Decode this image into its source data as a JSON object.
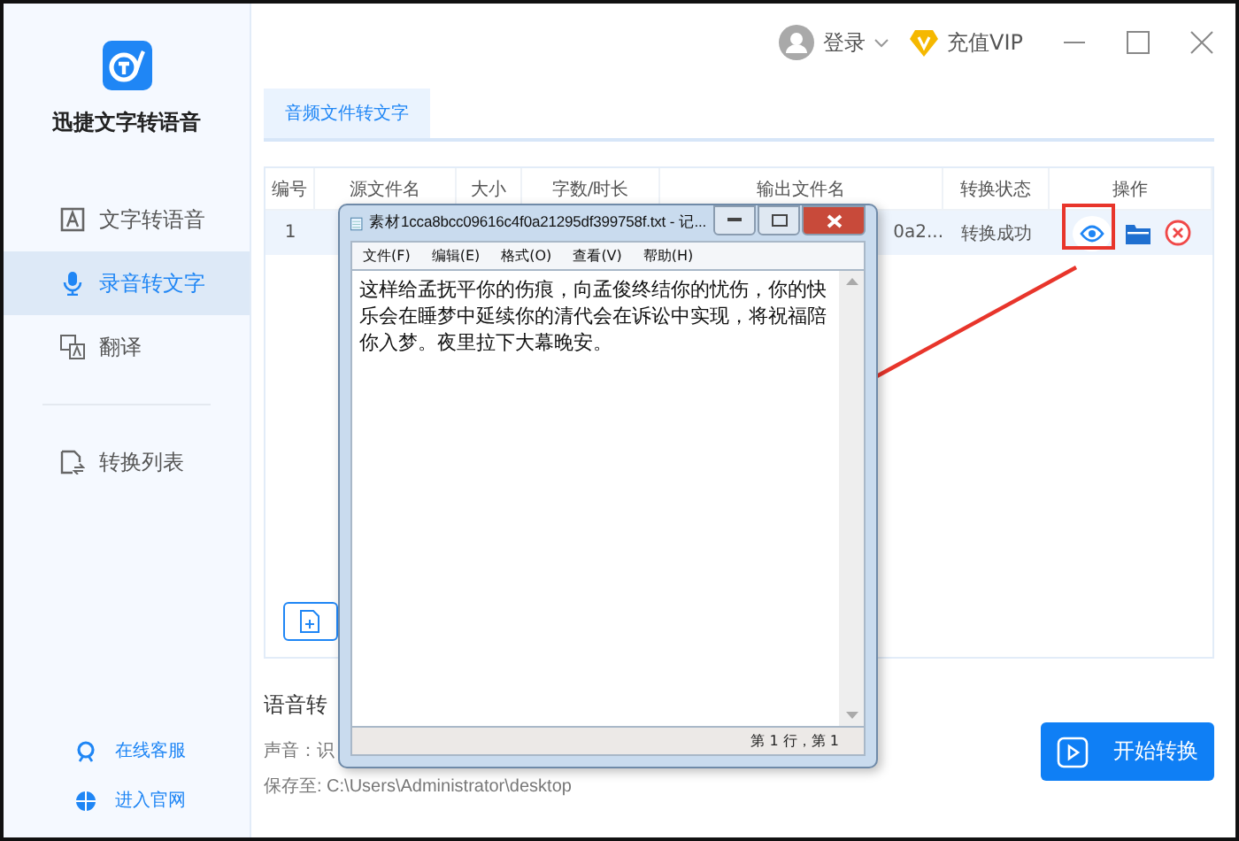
{
  "app": {
    "name": "迅捷文字转语音"
  },
  "sidebar": {
    "items": [
      {
        "label": "文字转语音",
        "selected": false
      },
      {
        "label": "录音转文字",
        "selected": true
      },
      {
        "label": "翻译",
        "selected": false
      },
      {
        "label": "转换列表",
        "selected": false
      }
    ],
    "links": [
      "在线客服",
      "进入官网"
    ]
  },
  "header": {
    "login": "登录",
    "vip": "充值VIP"
  },
  "tabs": [
    {
      "label": "音频文件转文字",
      "selected": true
    }
  ],
  "table": {
    "columns": [
      "编号",
      "源文件名",
      "大小",
      "字数/时长",
      "输出文件名",
      "转换状态",
      "操作"
    ],
    "rows": [
      {
        "index": "1",
        "output_name": "0a2...",
        "status": "转换成功",
        "selected": true
      }
    ]
  },
  "settings": {
    "title": "语音转",
    "voice": "声音：识",
    "save_path": "保存至: C:\\Users\\Administrator\\desktop"
  },
  "start_button": "开始转换",
  "notepad": {
    "title": "素材1cca8bcc09616c4f0a21295df399758f.txt - 记...",
    "menu": [
      "文件(F)",
      "编辑(E)",
      "格式(O)",
      "查看(V)",
      "帮助(H)"
    ],
    "content": "这样给孟抚平你的伤痕，向孟俊终结你的忧伤，你的快乐会在睡梦中延续你的清代会在诉讼中实现，将祝福陪你入梦。夜里拉下大幕晚安。",
    "status": "第 1 行，第 1"
  }
}
